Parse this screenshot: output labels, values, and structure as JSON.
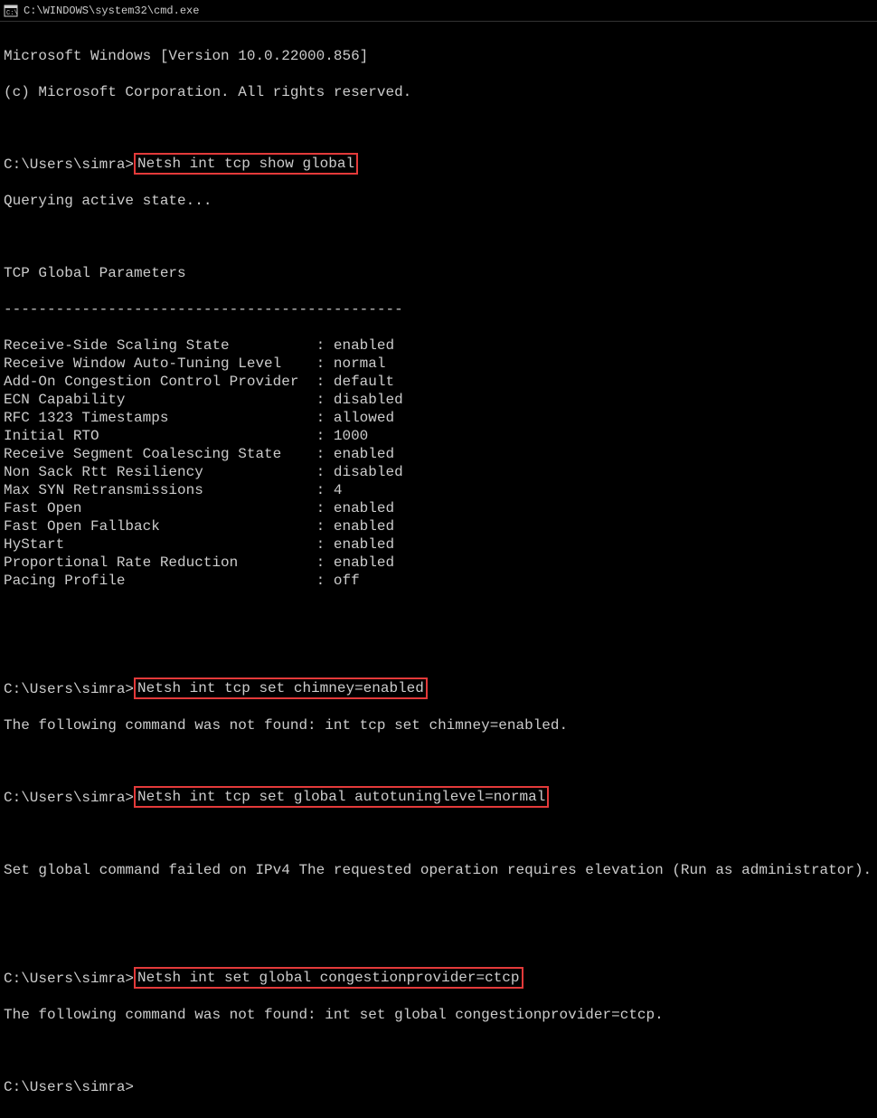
{
  "titlebar": {
    "text": "C:\\WINDOWS\\system32\\cmd.exe"
  },
  "header": {
    "line1": "Microsoft Windows [Version 10.0.22000.856]",
    "line2": "(c) Microsoft Corporation. All rights reserved."
  },
  "prompt": "C:\\Users\\simra>",
  "commands": {
    "cmd1": "Netsh int tcp show global",
    "cmd2": "Netsh int tcp set chimney=enabled",
    "cmd3": "Netsh int tcp set global autotuninglevel=normal",
    "cmd4": "Netsh int set global congestionprovider=ctcp"
  },
  "output1": {
    "querying": "Querying active state...",
    "title": "TCP Global Parameters",
    "separator": "----------------------------------------------",
    "params": [
      {
        "label": "Receive-Side Scaling State          : ",
        "value": "enabled"
      },
      {
        "label": "Receive Window Auto-Tuning Level    : ",
        "value": "normal"
      },
      {
        "label": "Add-On Congestion Control Provider  : ",
        "value": "default"
      },
      {
        "label": "ECN Capability                      : ",
        "value": "disabled"
      },
      {
        "label": "RFC 1323 Timestamps                 : ",
        "value": "allowed"
      },
      {
        "label": "Initial RTO                         : ",
        "value": "1000"
      },
      {
        "label": "Receive Segment Coalescing State    : ",
        "value": "enabled"
      },
      {
        "label": "Non Sack Rtt Resiliency             : ",
        "value": "disabled"
      },
      {
        "label": "Max SYN Retransmissions             : ",
        "value": "4"
      },
      {
        "label": "Fast Open                           : ",
        "value": "enabled"
      },
      {
        "label": "Fast Open Fallback                  : ",
        "value": "enabled"
      },
      {
        "label": "HyStart                             : ",
        "value": "enabled"
      },
      {
        "label": "Proportional Rate Reduction         : ",
        "value": "enabled"
      },
      {
        "label": "Pacing Profile                      : ",
        "value": "off"
      }
    ]
  },
  "output2": "The following command was not found: int tcp set chimney=enabled.",
  "output3": "Set global command failed on IPv4 The requested operation requires elevation (Run as administrator).",
  "output4": "The following command was not found: int set global congestionprovider=ctcp."
}
